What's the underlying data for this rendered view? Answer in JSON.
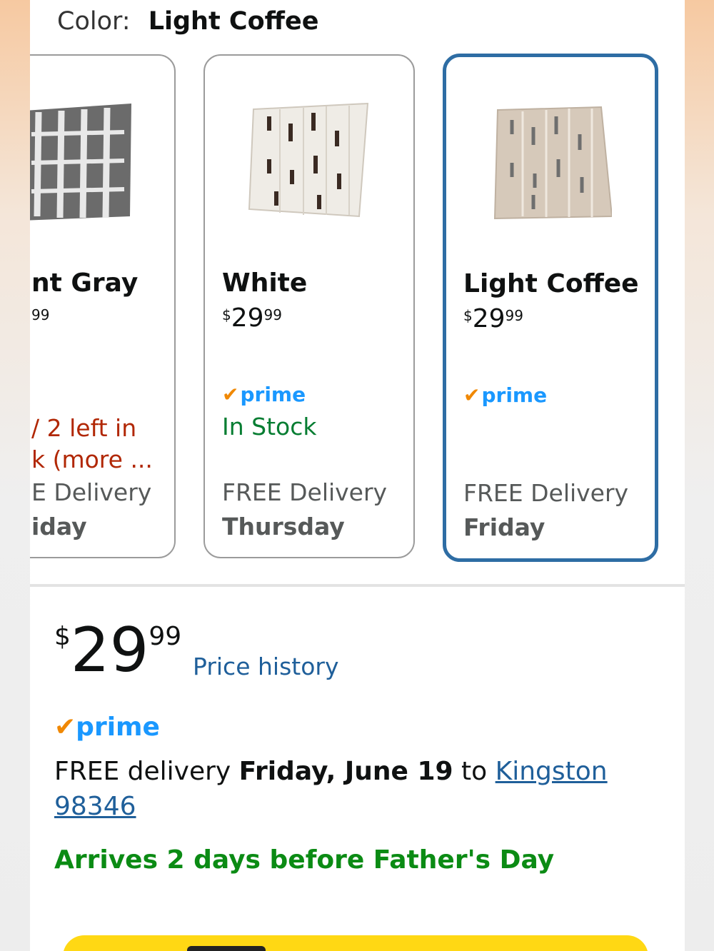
{
  "header": {
    "color_label": "Color:",
    "color_value": "Light Coffee"
  },
  "variants": [
    {
      "name": "nt Gray",
      "price_fraction": "99",
      "stock_line1": "/ 2 left in",
      "stock_line2": "k (more ...",
      "delivery_label": "E Delivery",
      "delivery_day": "iday",
      "thumb_colors": {
        "base": "#6b6b6b",
        "stripe": "#e8e8e8"
      }
    },
    {
      "name": "White",
      "price_symbol": "$",
      "price_whole": "29",
      "price_fraction": "99",
      "prime": "prime",
      "stock": "In Stock",
      "delivery_label": "FREE Delivery",
      "delivery_day": "Thursday",
      "thumb_colors": {
        "base": "#efece6",
        "stripe": "#3a2a22"
      }
    },
    {
      "name": "Light Coffee",
      "price_symbol": "$",
      "price_whole": "29",
      "price_fraction": "99",
      "prime": "prime",
      "delivery_label": "FREE Delivery",
      "delivery_day": "Friday",
      "selected": true,
      "thumb_colors": {
        "base": "#d6c9ba",
        "stripe": "#6e6e6e"
      }
    }
  ],
  "price": {
    "symbol": "$",
    "whole": "29",
    "fraction": "99",
    "history_link": "Price history"
  },
  "prime_badge": "prime",
  "delivery": {
    "prefix": "FREE delivery ",
    "date": "Friday, June 19",
    "to": " to ",
    "location": "Kingston 98346"
  },
  "arrives": "Arrives 2 days before Father's Day",
  "colors": {
    "selected_border": "#2e6da4",
    "prime_blue": "#1a98ff",
    "prime_check": "#f08804",
    "in_stock_green": "#067d32",
    "low_stock_red": "#b12704",
    "link_blue": "#1f5f9a",
    "arrives_green": "#0b8b14",
    "buy_button": "#ffd814"
  }
}
